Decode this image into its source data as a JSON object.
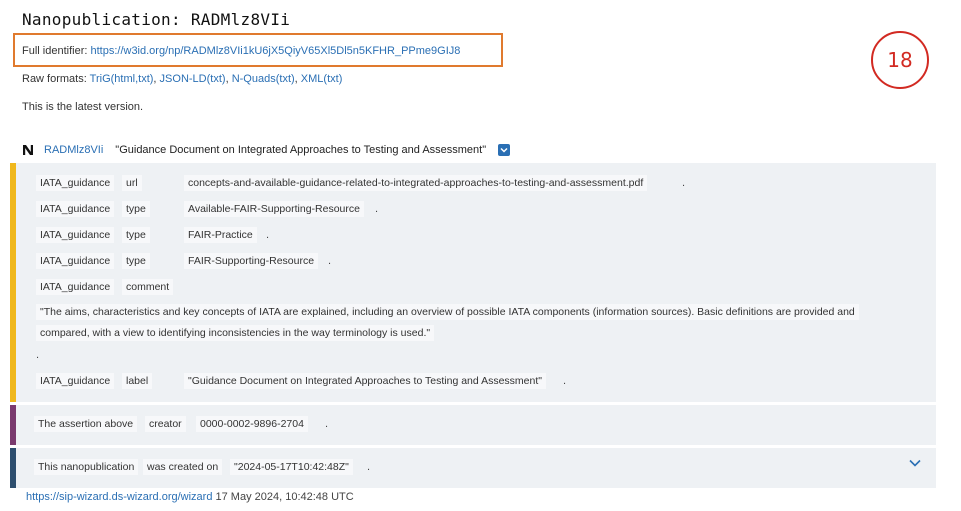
{
  "header": {
    "title": "Nanopublication: RADMlz8VIi",
    "full_identifier_label": "Full identifier:",
    "full_identifier_url": "https://w3id.org/np/RADMlz8VIi1kU6jX5QiyV65Xl5Dl5n5KFHR_PPme9GIJ8",
    "raw_formats_label": "Raw formats:",
    "raw_formats": [
      {
        "name": "TriG",
        "sub": "(html,txt)"
      },
      {
        "name": "JSON-LD",
        "sub": "(txt)"
      },
      {
        "name": "N-Quads",
        "sub": "(txt)"
      },
      {
        "name": "XML",
        "sub": "(txt)"
      }
    ],
    "version_note": "This is the latest version.",
    "badge_number": "18"
  },
  "nanopub": {
    "id": "RADMlz8VIi",
    "label": "\"Guidance Document on Integrated Approaches to Testing and Assessment\""
  },
  "assertion": {
    "rows": [
      {
        "subject": "IATA_guidance",
        "predicate": "url",
        "object": "concepts-and-available-guidance-related-to-integrated-approaches-to-testing-and-assessment.pdf"
      },
      {
        "subject": "IATA_guidance",
        "predicate": "type",
        "object": "Available-FAIR-Supporting-Resource"
      },
      {
        "subject": "IATA_guidance",
        "predicate": "type",
        "object": "FAIR-Practice"
      },
      {
        "subject": "IATA_guidance",
        "predicate": "type",
        "object": "FAIR-Supporting-Resource"
      },
      {
        "subject": "IATA_guidance",
        "predicate": "comment",
        "object": ""
      },
      {
        "subject": "IATA_guidance",
        "predicate": "label",
        "object": "\"Guidance Document on Integrated Approaches to Testing and Assessment\""
      }
    ],
    "comment_line1": "\"The aims, characteristics and key concepts of IATA are explained, including an overview of possible IATA components (information sources). Basic definitions are provided and",
    "comment_line2": "compared, with a view to identifying inconsistencies in the way terminology is used.\"",
    "dot": "."
  },
  "provenance": {
    "subject": "The assertion above",
    "predicate": "creator",
    "object": "0000-0002-9896-2704",
    "dot": "."
  },
  "pubinfo": {
    "subject": "This nanopublication",
    "predicate": "was created on",
    "object": "\"2024-05-17T10:42:48Z\"",
    "dot": "."
  },
  "footer": {
    "source_url": "https://sip-wizard.ds-wizard.org/wizard",
    "date": "17 May 2024, 10:42:48 UTC"
  },
  "colors": {
    "assertion": "#f0b81d",
    "provenance": "#7a3a6e",
    "pubinfo": "#2d4e6e",
    "highlight": "#e07a2e",
    "badge": "#d22a22",
    "link": "#2a6fb4"
  }
}
